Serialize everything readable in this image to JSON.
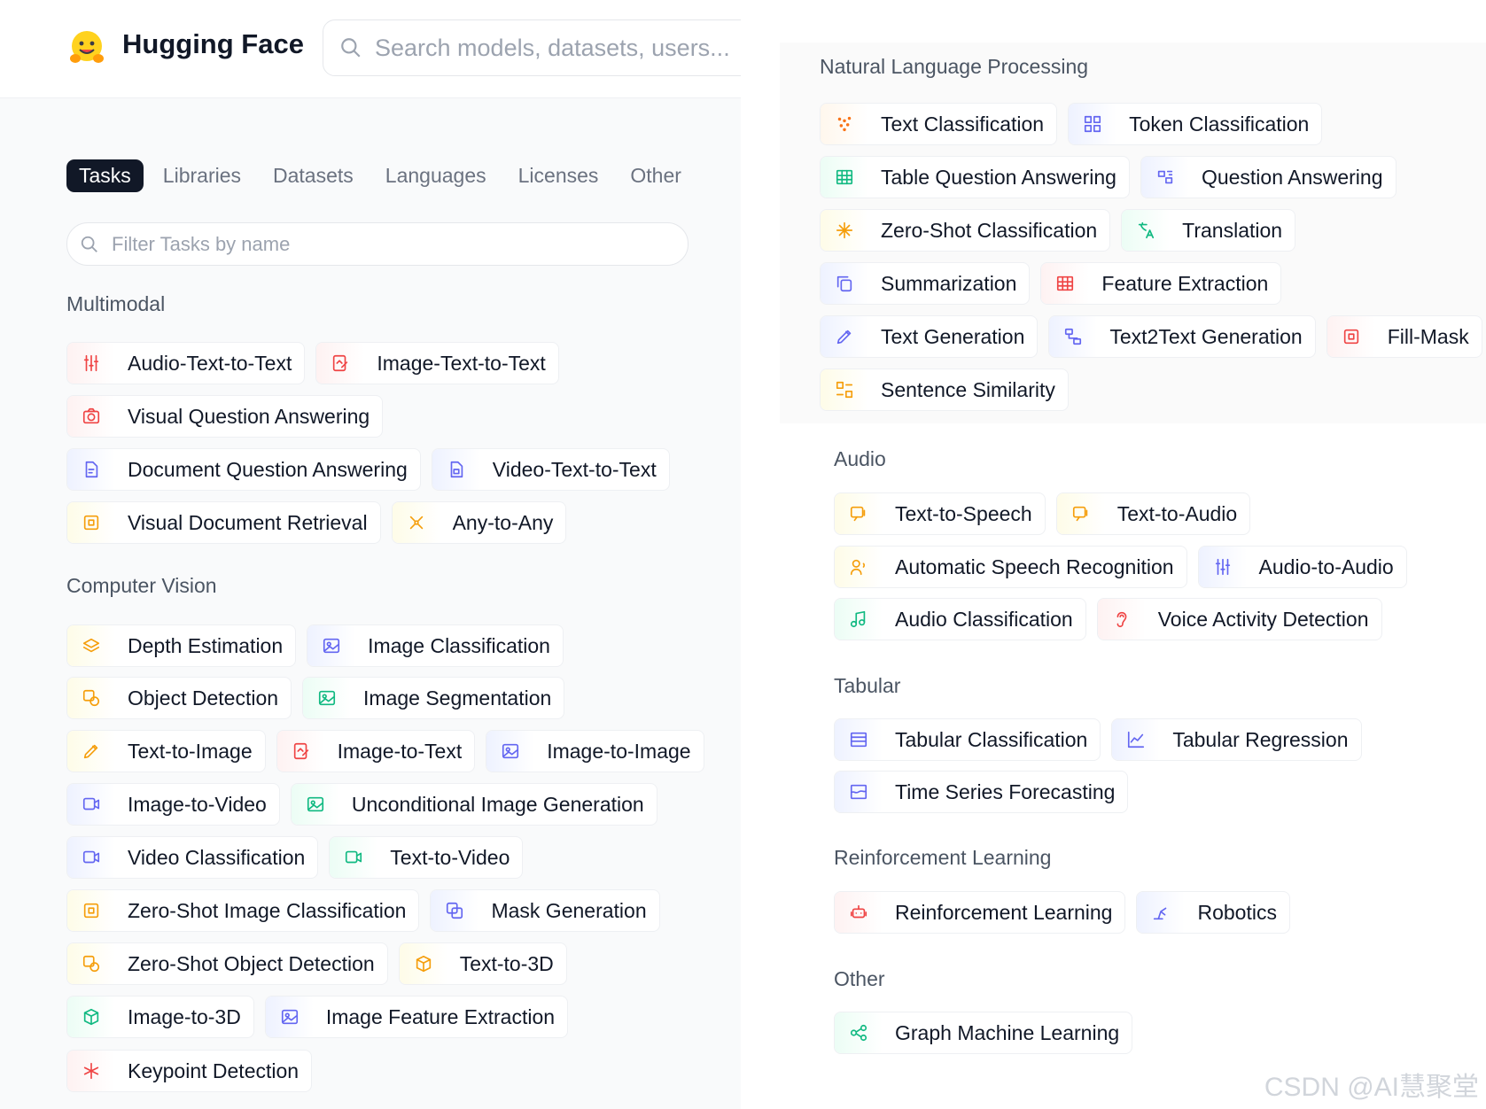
{
  "header": {
    "brand": "Hugging Face",
    "search_placeholder": "Search models, datasets, users..."
  },
  "tabs": [
    "Tasks",
    "Libraries",
    "Datasets",
    "Languages",
    "Licenses",
    "Other"
  ],
  "filter": {
    "placeholder": "Filter Tasks by name"
  },
  "sections": {
    "multimodal": {
      "title": "Multimodal",
      "rows": [
        [
          {
            "label": "Audio-Text-to-Text",
            "color": "red",
            "icon": "sliders-icon"
          },
          {
            "label": "Image-Text-to-Text",
            "color": "red",
            "icon": "image-edit-icon"
          }
        ],
        [
          {
            "label": "Visual Question Answering",
            "color": "red",
            "icon": "camera-icon"
          }
        ],
        [
          {
            "label": "Document Question Answering",
            "color": "blue",
            "icon": "document-icon"
          },
          {
            "label": "Video-Text-to-Text",
            "color": "blue",
            "icon": "document-video-icon"
          }
        ],
        [
          {
            "label": "Visual Document Retrieval",
            "color": "yellow",
            "icon": "frame-icon"
          },
          {
            "label": "Any-to-Any",
            "color": "yellow",
            "icon": "nodes-icon"
          }
        ]
      ]
    },
    "cv": {
      "title": "Computer Vision",
      "rows": [
        [
          {
            "label": "Depth Estimation",
            "color": "yellow",
            "icon": "layers-icon"
          },
          {
            "label": "Image Classification",
            "color": "blue",
            "icon": "image-icon"
          }
        ],
        [
          {
            "label": "Object Detection",
            "color": "yellow",
            "icon": "object-icon"
          },
          {
            "label": "Image Segmentation",
            "color": "green",
            "icon": "image-icon"
          }
        ],
        [
          {
            "label": "Text-to-Image",
            "color": "yellow",
            "icon": "pencil-icon"
          },
          {
            "label": "Image-to-Text",
            "color": "red",
            "icon": "image-edit-icon"
          },
          {
            "label": "Image-to-Image",
            "color": "blue",
            "icon": "image-icon"
          }
        ],
        [
          {
            "label": "Image-to-Video",
            "color": "blue",
            "icon": "video-icon"
          },
          {
            "label": "Unconditional Image Generation",
            "color": "green",
            "icon": "image-icon"
          }
        ],
        [
          {
            "label": "Video Classification",
            "color": "blue",
            "icon": "video-icon"
          },
          {
            "label": "Text-to-Video",
            "color": "green",
            "icon": "video-icon"
          }
        ],
        [
          {
            "label": "Zero-Shot Image Classification",
            "color": "yellow",
            "icon": "frame-icon"
          },
          {
            "label": "Mask Generation",
            "color": "blue",
            "icon": "mask-icon"
          }
        ],
        [
          {
            "label": "Zero-Shot Object Detection",
            "color": "yellow",
            "icon": "object-icon"
          },
          {
            "label": "Text-to-3D",
            "color": "yellow",
            "icon": "cube-icon"
          }
        ],
        [
          {
            "label": "Image-to-3D",
            "color": "green",
            "icon": "cube-icon"
          },
          {
            "label": "Image Feature Extraction",
            "color": "blue",
            "icon": "image-icon"
          }
        ],
        [
          {
            "label": "Keypoint Detection",
            "color": "red",
            "icon": "asterisk-icon"
          }
        ]
      ]
    },
    "nlp": {
      "title": "Natural Language Processing",
      "rows": [
        [
          {
            "label": "Text Classification",
            "color": "orange",
            "icon": "dots-icon"
          },
          {
            "label": "Token Classification",
            "color": "blue",
            "icon": "grid-icon"
          }
        ],
        [
          {
            "label": "Table Question Answering",
            "color": "green",
            "icon": "table-icon"
          },
          {
            "label": "Question Answering",
            "color": "blue",
            "icon": "qa-icon"
          }
        ],
        [
          {
            "label": "Zero-Shot Classification",
            "color": "yellow",
            "icon": "sparkle-icon"
          },
          {
            "label": "Translation",
            "color": "green",
            "icon": "translate-icon"
          }
        ],
        [
          {
            "label": "Summarization",
            "color": "blue",
            "icon": "copy-icon"
          },
          {
            "label": "Feature Extraction",
            "color": "red",
            "icon": "table-icon"
          }
        ],
        [
          {
            "label": "Text Generation",
            "color": "blue",
            "icon": "pencil-icon"
          },
          {
            "label": "Text2Text Generation",
            "color": "blue",
            "icon": "flow-icon"
          },
          {
            "label": "Fill-Mask",
            "color": "red",
            "icon": "frame-icon"
          }
        ],
        [
          {
            "label": "Sentence Similarity",
            "color": "yellow",
            "icon": "compare-icon"
          }
        ]
      ]
    },
    "audio": {
      "title": "Audio",
      "rows": [
        [
          {
            "label": "Text-to-Speech",
            "color": "yellow",
            "icon": "speech-icon"
          },
          {
            "label": "Text-to-Audio",
            "color": "yellow",
            "icon": "speech-icon"
          }
        ],
        [
          {
            "label": "Automatic Speech Recognition",
            "color": "yellow",
            "icon": "user-voice-icon"
          },
          {
            "label": "Audio-to-Audio",
            "color": "blue",
            "icon": "sliders-icon"
          }
        ],
        [
          {
            "label": "Audio Classification",
            "color": "green",
            "icon": "music-icon"
          },
          {
            "label": "Voice Activity Detection",
            "color": "red",
            "icon": "ear-icon"
          }
        ]
      ]
    },
    "tabular": {
      "title": "Tabular",
      "rows": [
        [
          {
            "label": "Tabular Classification",
            "color": "blue",
            "icon": "list-icon"
          },
          {
            "label": "Tabular Regression",
            "color": "blue",
            "icon": "line-chart-icon"
          }
        ],
        [
          {
            "label": "Time Series Forecasting",
            "color": "blue",
            "icon": "wave-icon"
          }
        ]
      ]
    },
    "rl": {
      "title": "Reinforcement Learning",
      "rows": [
        [
          {
            "label": "Reinforcement Learning",
            "color": "red",
            "icon": "robot-icon"
          },
          {
            "label": "Robotics",
            "color": "blue",
            "icon": "robot-arm-icon"
          }
        ]
      ]
    },
    "other": {
      "title": "Other",
      "rows": [
        [
          {
            "label": "Graph Machine Learning",
            "color": "green",
            "icon": "graph-icon"
          }
        ]
      ]
    }
  },
  "watermark": "CSDN @AI慧聚堂",
  "colors": {
    "red": "#ef4444",
    "blue": "#6366f1",
    "yellow": "#f59e0b",
    "green": "#10b981",
    "orange": "#f97316"
  }
}
